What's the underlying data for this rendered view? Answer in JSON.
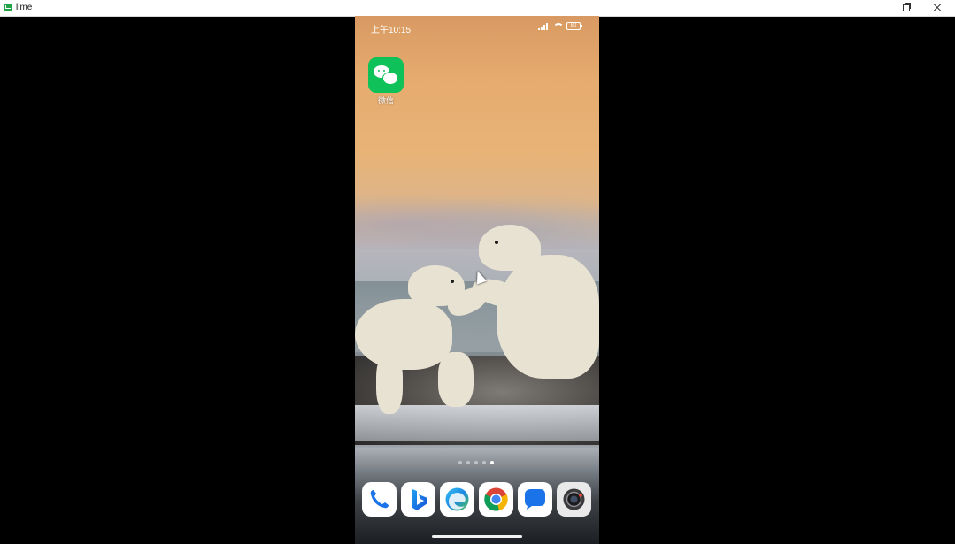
{
  "window": {
    "title": "lime"
  },
  "status_bar": {
    "time": "上午10:15",
    "battery": "80"
  },
  "home": {
    "apps": [
      {
        "label": "微信",
        "icon": "wechat-icon"
      }
    ],
    "page_indicator": {
      "pages": 5,
      "current": 5
    },
    "dock": [
      {
        "name": "phone-app",
        "icon": "phone-icon"
      },
      {
        "name": "bing-app",
        "icon": "bing-icon"
      },
      {
        "name": "edge-app",
        "icon": "edge-icon"
      },
      {
        "name": "chrome-app",
        "icon": "chrome-icon"
      },
      {
        "name": "messages-app",
        "icon": "messages-icon"
      },
      {
        "name": "camera-app",
        "icon": "camera-icon"
      }
    ]
  },
  "colors": {
    "wechat_green": "#0fc159",
    "phone_blue": "#1a73e8",
    "titlebar_bg": "#ffffff"
  }
}
